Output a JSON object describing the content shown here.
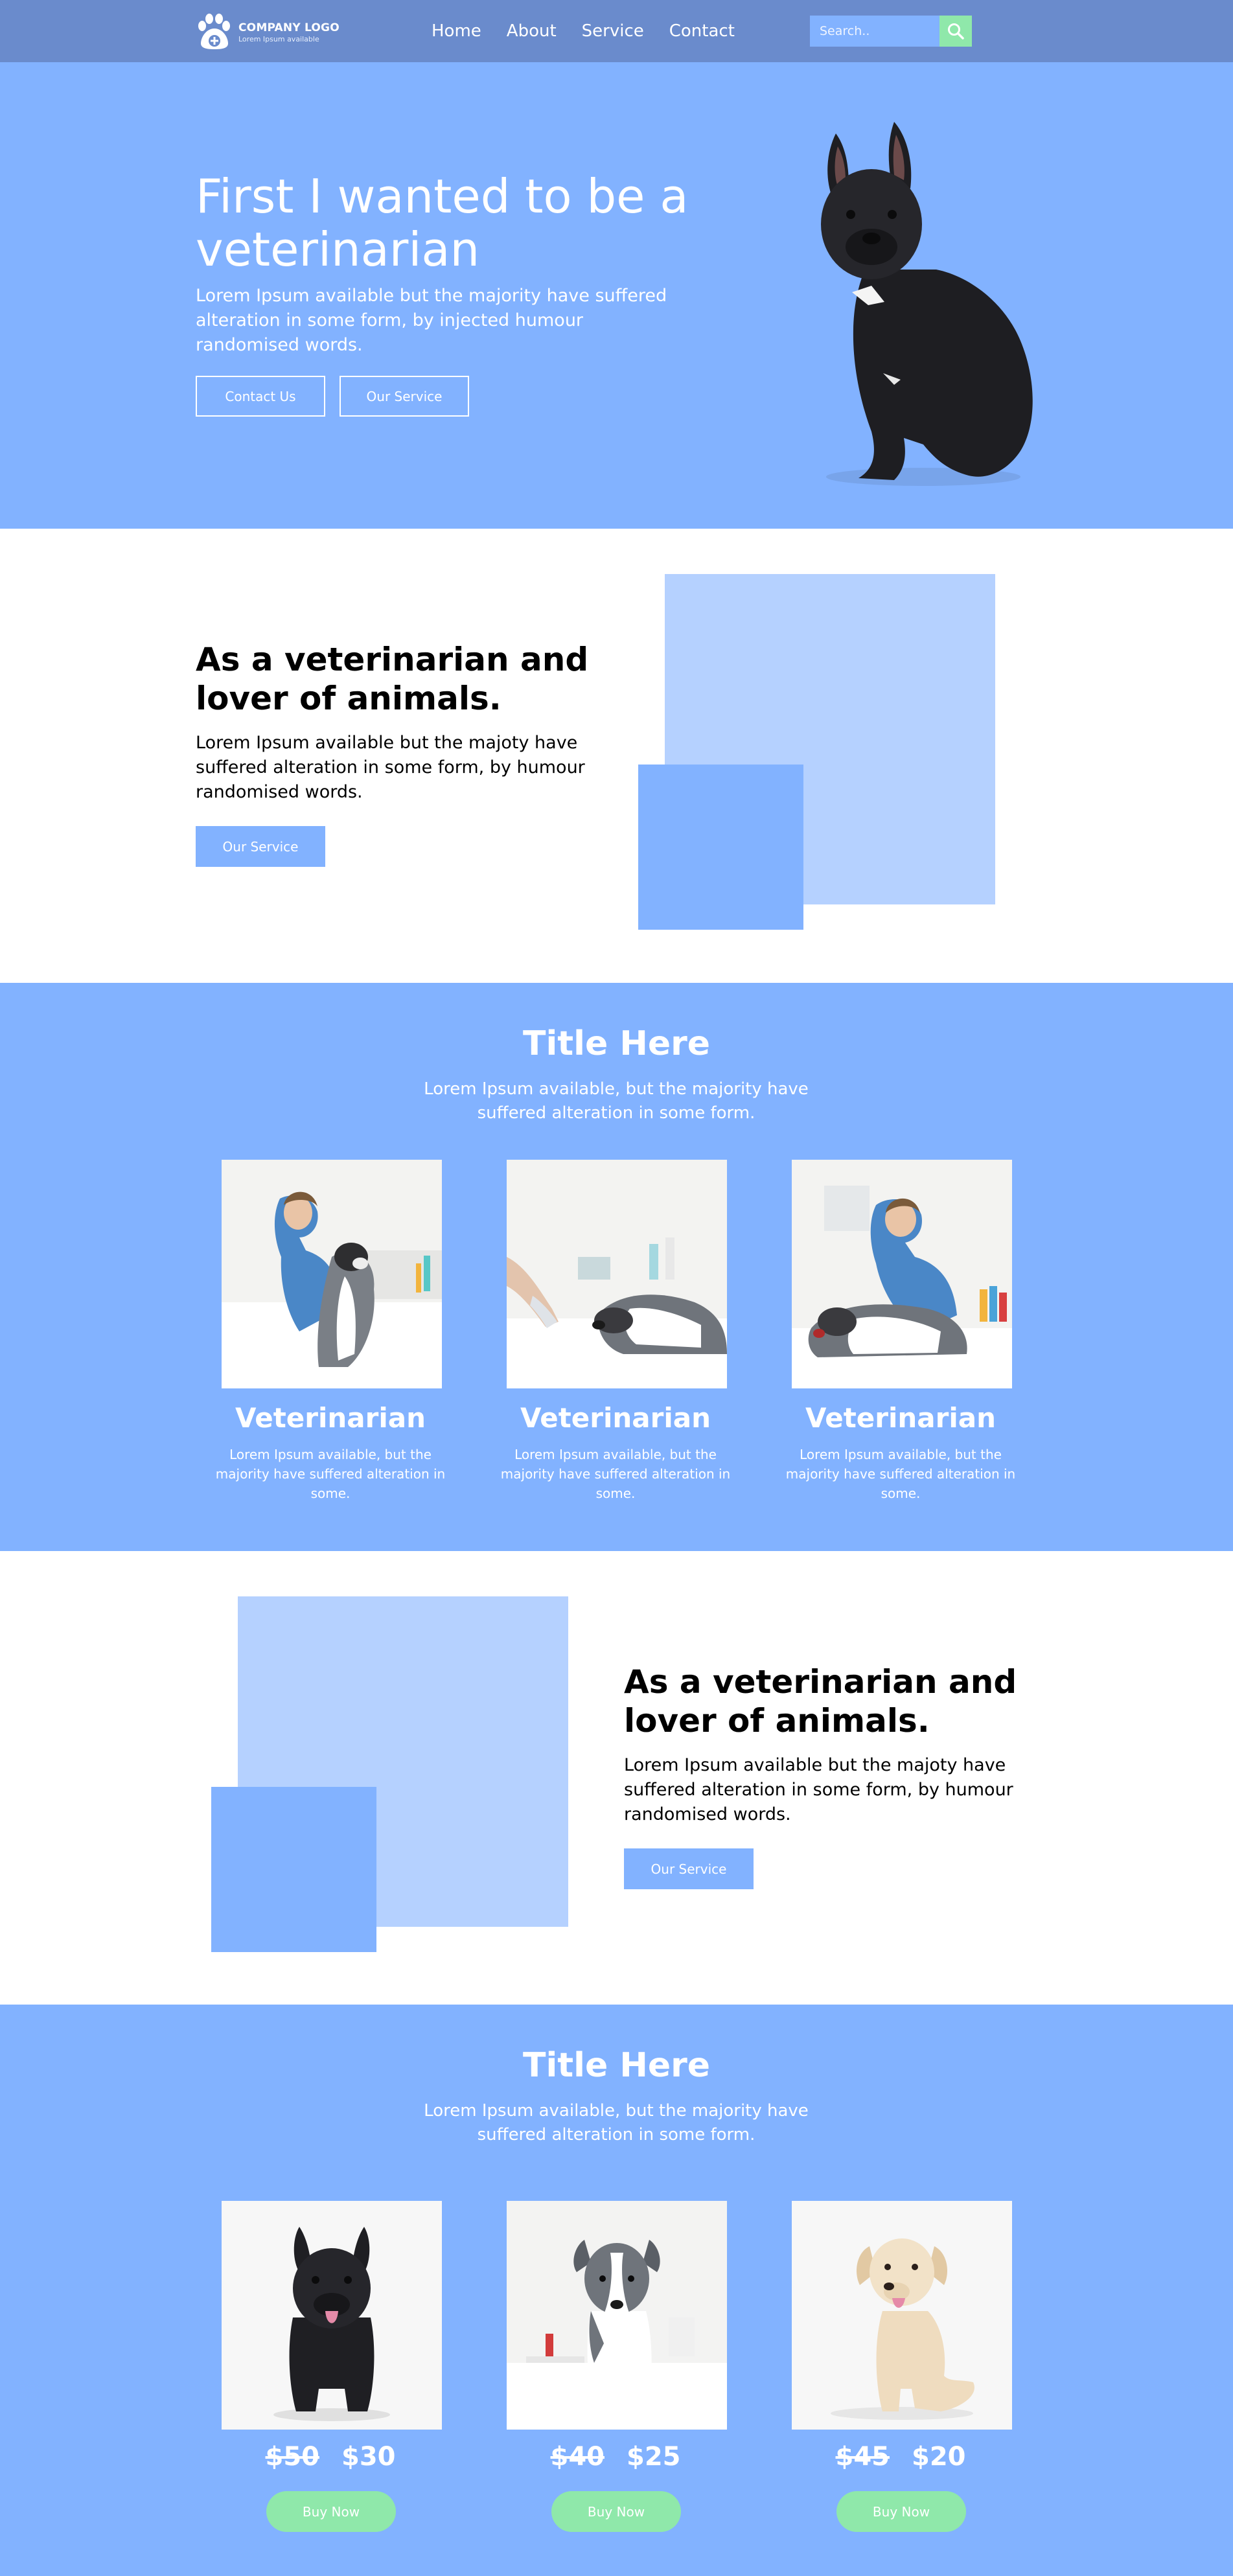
{
  "header": {
    "logo_title": "COMPANY LOGO",
    "logo_subtitle": "Lorem Ipsum available",
    "nav": [
      "Home",
      "About",
      "Service",
      "Contact"
    ],
    "search_placeholder": "Search..",
    "colors": {
      "header_bg": "#6a8bcc",
      "search_button": "#8fe8aa"
    }
  },
  "hero": {
    "title": "First I wanted to be a veterinarian",
    "text": "Lorem Ipsum available but the majority have suffered alteration in some form, by injected humour randomised words.",
    "button_contact": "Contact Us",
    "button_service": "Our Service"
  },
  "feature1": {
    "title": "As a veterinarian and lover of animals.",
    "text": "Lorem Ipsum available but the majoty have suffered alteration in some form, by humour randomised words.",
    "button": "Our Service"
  },
  "team": {
    "title": "Title Here",
    "subtitle": "Lorem Ipsum available, but the majority have suffered alteration in some form.",
    "cards": [
      {
        "title": "Veterinarian",
        "text": "Lorem Ipsum available, but the majority have suffered alteration in some."
      },
      {
        "title": "Veterinarian",
        "text": "Lorem Ipsum available, but the majority have suffered alteration in some."
      },
      {
        "title": "Veterinarian",
        "text": "Lorem Ipsum available, but the majority have suffered alteration in some."
      }
    ]
  },
  "feature2": {
    "title": "As a veterinarian and lover of animals.",
    "text": "Lorem Ipsum available but the majoty have suffered alteration in some form, by humour randomised words.",
    "button": "Our Service"
  },
  "shop": {
    "title": "Title Here",
    "subtitle": "Lorem Ipsum available, but the majority have suffered alteration in some form.",
    "items": [
      {
        "old_price": "$50",
        "price": "$30",
        "button": "Buy Now"
      },
      {
        "old_price": "$40",
        "price": "$25",
        "button": "Buy Now"
      },
      {
        "old_price": "$45",
        "price": "$20",
        "button": "Buy Now"
      }
    ]
  },
  "colors": {
    "primary_blue": "#82b2ff",
    "light_blue": "#b5d1ff",
    "accent_green": "#8fe8aa"
  }
}
